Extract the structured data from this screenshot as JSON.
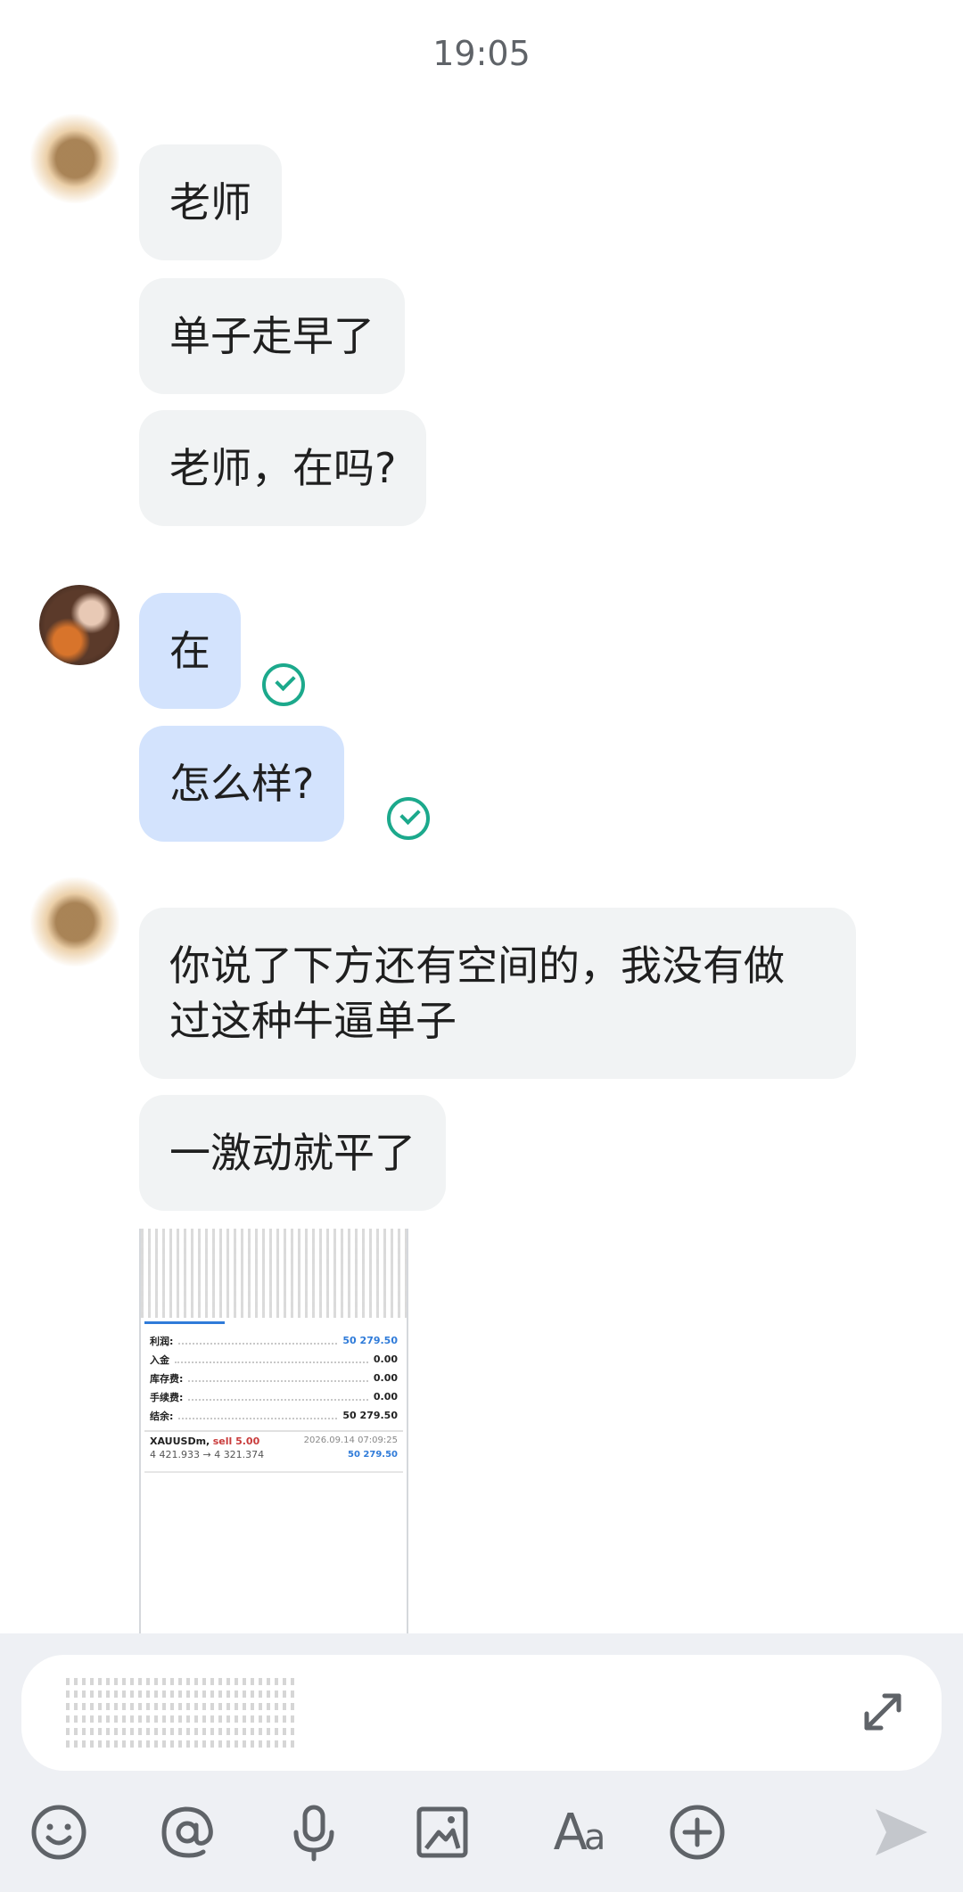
{
  "header": {
    "time": "19:05"
  },
  "messages": [
    {
      "text": "老师"
    },
    {
      "text": "单子走早了"
    },
    {
      "text": "老师，在吗?"
    },
    {
      "text": "在"
    },
    {
      "text": "怎么样?"
    },
    {
      "text": "你说了下方还有空间的，我没有做\n过这种牛逼单子"
    },
    {
      "text": "一激动就平了"
    }
  ],
  "screenshot": {
    "rows": [
      {
        "label": "利润:",
        "value": "50 279.50"
      },
      {
        "label": "入金",
        "value": "0.00"
      },
      {
        "label": "库存费:",
        "value": "0.00"
      },
      {
        "label": "手续费:",
        "value": "0.00"
      },
      {
        "label": "结余:",
        "value": "50 279.50"
      }
    ],
    "trade": {
      "symbol": "XAUUSDm,",
      "side": "sell 5.00",
      "datetime": "2026.09.14 07:09:25",
      "prices": "4 421.933 → 4 321.374",
      "profit": "50 279.50"
    }
  },
  "composer": {
    "icons": [
      "emoji-icon",
      "at-icon",
      "microphone-icon",
      "image-icon",
      "font-icon",
      "plus-circle-icon",
      "send-icon"
    ],
    "font_label_big": "A",
    "font_label_small": "a"
  },
  "colors": {
    "incoming_bubble": "#f1f3f4",
    "outgoing_bubble": "#d3e3fd",
    "read_check": "#1ca98c",
    "accent_blue": "#2f7bd9"
  }
}
